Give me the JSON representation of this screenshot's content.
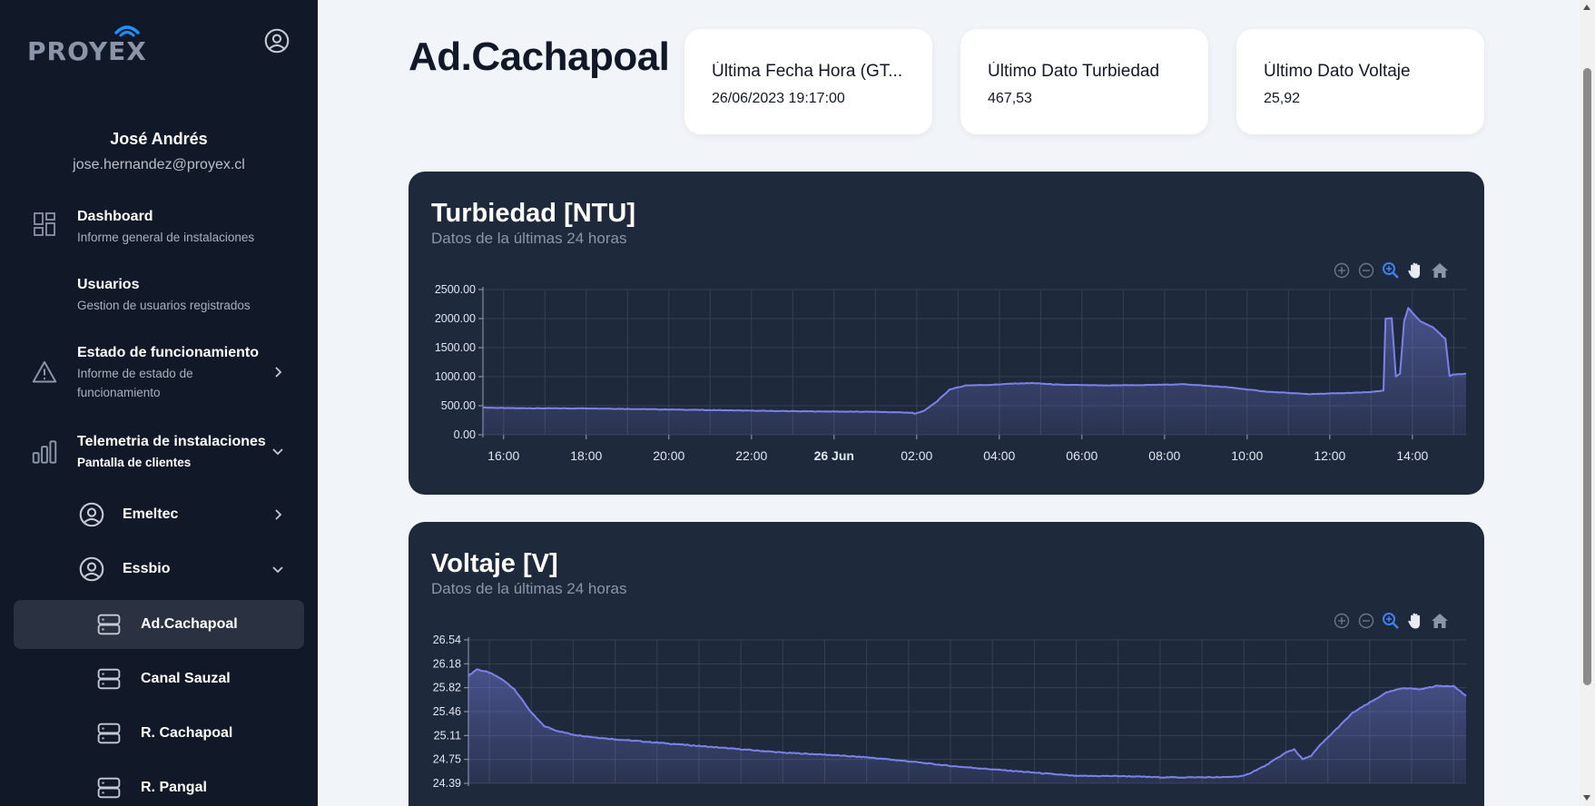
{
  "brand": {
    "name": "PROYEX"
  },
  "user": {
    "name": "José Andrés",
    "email": "jose.hernandez@proyex.cl"
  },
  "nav": [
    {
      "title": "Dashboard",
      "subtitle": "Informe general de instalaciones",
      "icon": "dashboard-icon"
    },
    {
      "title": "Usuarios",
      "subtitle": "Gestion de usuarios registrados",
      "icon": "users-icon"
    },
    {
      "title": "Estado de funcionamiento",
      "subtitle": "Informe de estado de",
      "subtitle2": "funcionamiento",
      "icon": "warning-icon"
    },
    {
      "title": "Telemetria de instalaciones",
      "subtitle": "Pantalla de clientes",
      "icon": "bar-chart-icon"
    }
  ],
  "clients": [
    {
      "label": "Emeltec",
      "expanded": false
    },
    {
      "label": "Essbio",
      "expanded": true
    }
  ],
  "stations": [
    {
      "label": "Ad.Cachapoal",
      "active": true
    },
    {
      "label": "Canal Sauzal",
      "active": false
    },
    {
      "label": "R. Cachapoal",
      "active": false
    },
    {
      "label": "R. Pangal",
      "active": false
    }
  ],
  "page": {
    "title": "Ad.Cachapoal"
  },
  "cards": [
    {
      "label": "Última Fecha Hora (GT...",
      "value": "26/06/2023 19:17:00"
    },
    {
      "label": "Último Dato Turbiedad",
      "value": "467,53"
    },
    {
      "label": "Último Dato Voltaje",
      "value": "25,92"
    }
  ],
  "colors": {
    "accent": "#7b83eb",
    "panel": "#1e293b",
    "sidebar": "#111827",
    "active_tool": "#3b82f6"
  },
  "chart_data": [
    {
      "type": "area",
      "title": "Turbiedad [NTU]",
      "subtitle": "Datos de la últimas 24 horas",
      "x_ticks": [
        "16:00",
        "18:00",
        "20:00",
        "22:00",
        "26 Jun",
        "02:00",
        "04:00",
        "06:00",
        "08:00",
        "10:00",
        "12:00",
        "14:00"
      ],
      "y_ticks": [
        "2500.00",
        "2000.00",
        "1500.00",
        "1000.00",
        "500.00",
        "0.00"
      ],
      "ylim": [
        0,
        2500
      ],
      "xlim_hours": [
        15.5,
        39.3
      ],
      "grid": true,
      "series": [
        {
          "x": [
            15.5,
            16,
            17,
            18,
            19,
            20,
            21,
            22,
            23,
            24,
            25,
            25.9,
            25.95,
            26.2,
            26.5,
            26.8,
            27.2,
            27.8,
            28.3,
            28.8,
            29.5,
            30.5,
            31.5,
            32.5,
            33.5,
            34.5,
            35.5,
            36.5,
            37.0,
            37.3,
            37.35,
            37.5,
            37.6,
            37.7,
            37.8,
            37.9,
            38.0,
            38.2,
            38.5,
            38.8,
            38.9,
            39.0,
            39.3
          ],
          "y": [
            470,
            460,
            455,
            455,
            445,
            435,
            425,
            415,
            405,
            400,
            395,
            380,
            360,
            420,
            580,
            780,
            850,
            860,
            880,
            890,
            860,
            850,
            855,
            870,
            820,
            740,
            700,
            720,
            735,
            760,
            2000,
            2010,
            1000,
            1050,
            1950,
            2180,
            2100,
            1950,
            1850,
            1650,
            1010,
            1040,
            1050
          ]
        }
      ]
    },
    {
      "type": "area",
      "title": "Voltaje [V]",
      "subtitle": "Datos de la últimas 24 horas",
      "y_ticks": [
        "26.54",
        "26.18",
        "25.82",
        "25.46",
        "25.11",
        "24.75",
        "24.39"
      ],
      "ylim": [
        24.39,
        26.54
      ],
      "xlim_hours": [
        15.5,
        39.3
      ],
      "grid": true,
      "series": [
        {
          "x": [
            15.5,
            15.7,
            16.0,
            16.3,
            16.6,
            17.0,
            17.3,
            17.6,
            18.0,
            18.5,
            19.0,
            20.0,
            21.0,
            22.0,
            23.0,
            24.0,
            25.0,
            26.0,
            27.0,
            28.0,
            29.0,
            30.0,
            31.0,
            32.0,
            33.0,
            33.5,
            34.0,
            34.5,
            35.0,
            35.2,
            35.4,
            35.6,
            35.8,
            36.2,
            36.6,
            37.0,
            37.4,
            37.8,
            38.2,
            38.6,
            39.0,
            39.3
          ],
          "y": [
            26.0,
            26.1,
            26.05,
            25.95,
            25.8,
            25.45,
            25.25,
            25.18,
            25.12,
            25.08,
            25.05,
            25.0,
            24.95,
            24.9,
            24.85,
            24.82,
            24.78,
            24.72,
            24.65,
            24.6,
            24.55,
            24.5,
            24.5,
            24.48,
            24.48,
            24.48,
            24.5,
            24.65,
            24.85,
            24.9,
            24.75,
            24.8,
            24.95,
            25.2,
            25.45,
            25.6,
            25.75,
            25.82,
            25.8,
            25.85,
            25.85,
            25.7
          ]
        }
      ]
    }
  ]
}
